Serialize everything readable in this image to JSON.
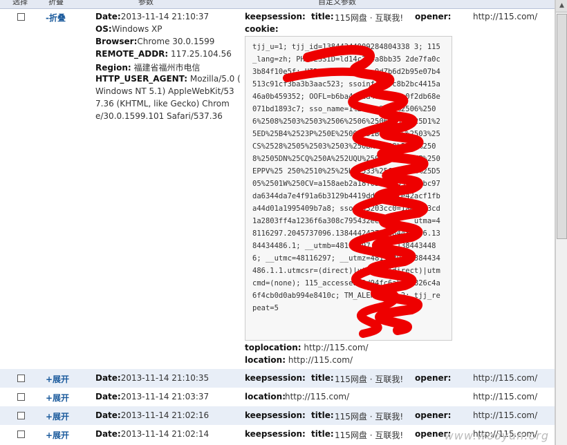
{
  "header": {
    "col1": "选择",
    "col2": "折叠",
    "col3": "参数",
    "col4": "自定义参数"
  },
  "expanded": {
    "toggle": "-折叠",
    "date_label": "Date:",
    "date": "2013-11-14 21:10:37",
    "os_label": "OS:",
    "os": "Windows XP",
    "browser_label": "Browser:",
    "browser": "Chrome 30.0.1599",
    "addr_label": "REMOTE_ADDR:",
    "addr": "117.25.104.56",
    "region_label": "Region:",
    "region": "福建省福州市电信",
    "ua_label": "HTTP_USER_AGENT:",
    "ua_lines": [
      "Mozilla/5.0 (",
      "Windows NT 5.1) AppleWebKit/53",
      "7.36 (KHTML, like Gecko) Chrom",
      "e/30.0.1599.101 Safari/537.36"
    ],
    "keepsession_label": "keepsession:",
    "title_label": "title:",
    "title": "115网盘 · 互联我!",
    "opener_label": "opener:",
    "opener": "http://115.com/",
    "cookie_label": "cookie:",
    "cookie": "tjj_u=1; tjj_id=13844344909284804338 3; 115_lang=zh; PHPSESSID=ld14c3f4a8bb35 2de7fa0c3b84f10e5f; UID=1004568; pp_9dZb6d2b95e07b4513c91cf3ba3b3aac523; ssoinfoA1=c8b2bc4415a46a0b459352; OOFL=b6ba4c4ca4a6b8b3a0f2db68e071bd1893c7; sso_name=1%2505%2505%2506%2506%2508%2503%2503%2506%2506%2506%2525%25D1%25ED%25B4%2523P%250E%2500%251BT%250F%2503%25CS%2528%2505%2503%2503%250BK%2528%2505%2508%2505DN%25CQ%250A%252UQU%2501%250A0TTP%250EPPV%25 250%2510%25%25H%2533%25CH%2504%25D505%2501W%250CV=a158aeb2a18f0353bcd51c66bc97da6344da7e4f91a6b3129b4419dda8903fe42acf1fba44d01a1995409b7a8; ssov_33203cc0=1ae33a3cd1a2803ff4a1236f6a308c795432ee1a0a; __utma=48116297.2045737096.1384442427.1384434486.1384434486.1; __utmb=48116297.2.10.1384434486; __utmc=48116297; __utmz=48116297.1384434486.1.1.utmcsr=(direct)|utmccn=(direct)|utmcmd=(none); 115_accessed=3d94fc6ab0dc826c4a6f4cb0d0ab994e8410c; TM_ALERT_IND=2; tjj_repeat=5",
    "toplocation_label": "toplocation:",
    "toplocation": "http://115.com/",
    "location_label": "location:",
    "location": "http://115.com/"
  },
  "rows": [
    {
      "toggle": "+展开",
      "date_label": "Date:",
      "date": "2013-11-14 21:10:35",
      "k1": "keepsession:",
      "title_label": "title:",
      "title": "115网盘 · 互联我!",
      "opener_label": "opener:",
      "opener": "http://115.com/"
    },
    {
      "toggle": "+展开",
      "date_label": "Date:",
      "date": "2013-11-14 21:03:37",
      "k1": "location:",
      "location": "http://115.com/",
      "opener": "http://115.com/"
    },
    {
      "toggle": "+展开",
      "date_label": "Date:",
      "date": "2013-11-14 21:02:16",
      "k1": "keepsession:",
      "title_label": "title:",
      "title": "115网盘 · 互联我!",
      "opener_label": "opener:",
      "opener": "http://115.com/"
    },
    {
      "toggle": "+展开",
      "date_label": "Date:",
      "date": "2013-11-14 21:02:14",
      "k1": "keepsession:",
      "title_label": "title:",
      "title": "115网盘 · 互联我!",
      "opener_label": "opener:",
      "opener": "http://115.com/"
    }
  ],
  "watermark": "www.wooyun.org"
}
